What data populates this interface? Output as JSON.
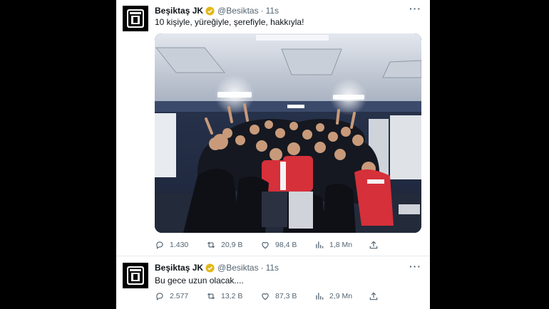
{
  "tweets": [
    {
      "name": "Beşiktaş JK",
      "handle": "@Besiktas",
      "separator": "·",
      "time": "11s",
      "text": "10 kişiyle, yüreğiyle, şerefiyle, hakkıyla!",
      "stats": {
        "replies": "1.430",
        "retweets": "20,9 B",
        "likes": "98,4 B",
        "views": "1,8 Mn"
      },
      "has_media": true
    },
    {
      "name": "Beşiktaş JK",
      "handle": "@Besiktas",
      "separator": "·",
      "time": "11s",
      "text": "Bu gece uzun olacak....",
      "stats": {
        "replies": "2.577",
        "retweets": "13,2 B",
        "likes": "87,3 B",
        "views": "2,9 Mn"
      },
      "has_media": false
    }
  ],
  "icons": {
    "more": "more-icon",
    "reply": "reply-icon",
    "retweet": "retweet-icon",
    "like": "heart-icon",
    "views": "views-icon",
    "share": "share-icon",
    "verified": "verified-badge-icon"
  },
  "colors": {
    "verified_gold": "#e2b719",
    "text": "#0f1419",
    "muted": "#536471"
  }
}
